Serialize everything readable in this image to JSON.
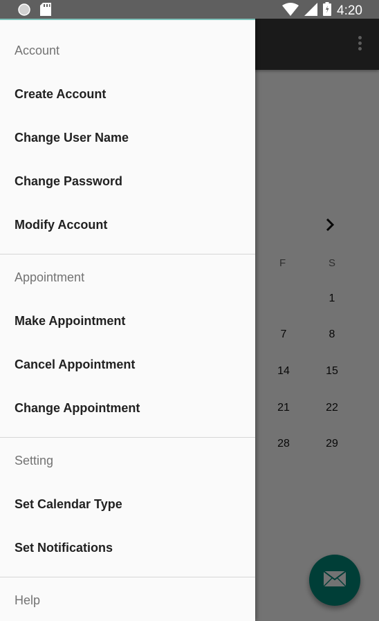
{
  "status_bar": {
    "time": "4:20",
    "icons": [
      "circle-icon",
      "sd-card-icon",
      "wifi-icon",
      "signal-icon",
      "battery-icon"
    ]
  },
  "app": {
    "toolbar_color": "#3b3b3b",
    "calendar": {
      "next_month": "›",
      "day_headers": [
        "F",
        "S"
      ],
      "rows": [
        [
          "",
          "1"
        ],
        [
          "7",
          "8"
        ],
        [
          "14",
          "15"
        ],
        [
          "21",
          "22"
        ],
        [
          "28",
          "29"
        ]
      ]
    },
    "fab_color": "#00897b"
  },
  "drawer": {
    "sections": [
      {
        "header": "Account",
        "items": [
          "Create Account",
          "Change User Name",
          "Change Password",
          "Modify Account"
        ]
      },
      {
        "header": "Appointment",
        "items": [
          "Make Appointment",
          "Cancel Appointment",
          "Change Appointment"
        ]
      },
      {
        "header": "Setting",
        "items": [
          "Set Calendar Type",
          "Set Notifications"
        ]
      },
      {
        "header": "Help",
        "items": []
      }
    ]
  }
}
